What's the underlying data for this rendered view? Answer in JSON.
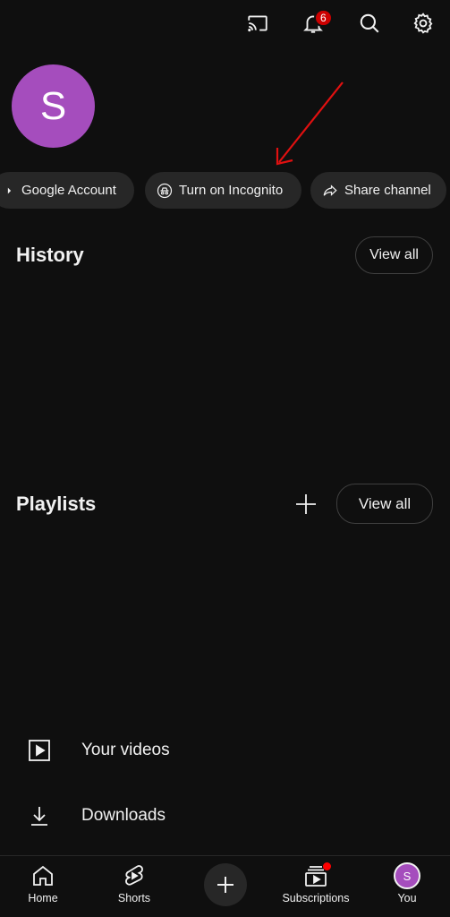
{
  "header": {
    "notification_count": "6",
    "icons": [
      "cast-icon",
      "bell-icon",
      "search-icon",
      "gear-icon"
    ]
  },
  "profile": {
    "avatar_letter": "S",
    "avatar_color": "#a54dbd"
  },
  "chips": [
    {
      "label": "Google Account",
      "icon": "google-icon"
    },
    {
      "label": "Turn on Incognito",
      "icon": "incognito-icon"
    },
    {
      "label": "Share channel",
      "icon": "share-icon"
    }
  ],
  "history": {
    "title": "History",
    "view_all": "View all"
  },
  "playlists": {
    "title": "Playlists",
    "view_all": "View all"
  },
  "menu": [
    {
      "label": "Your videos",
      "icon": "play-square-icon"
    },
    {
      "label": "Downloads",
      "icon": "download-icon"
    }
  ],
  "bottom_nav": [
    {
      "label": "Home",
      "icon": "home-icon"
    },
    {
      "label": "Shorts",
      "icon": "shorts-icon"
    },
    {
      "label": "",
      "icon": "plus-icon"
    },
    {
      "label": "Subscriptions",
      "icon": "subscriptions-icon"
    },
    {
      "label": "You",
      "icon": "avatar"
    }
  ],
  "colors": {
    "background": "#0f0f0f",
    "chip": "#272727",
    "badge": "#cc0000",
    "annotation_arrow": "#e01010"
  }
}
